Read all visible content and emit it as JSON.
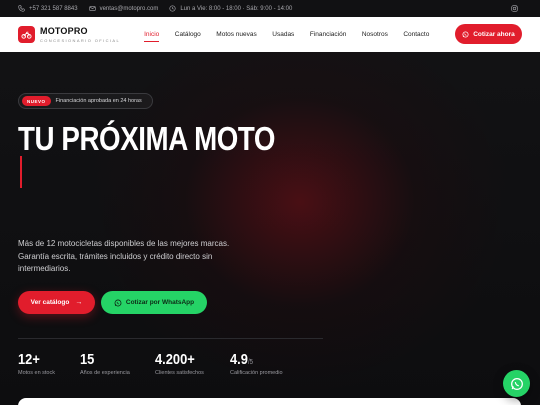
{
  "topbar": {
    "phone": "+57 321 587 8843",
    "email": "ventas@motopro.com",
    "hours": "Lun a Vie: 8:00 - 18:00 · Sáb: 9:00 - 14:00"
  },
  "nav": {
    "brand_name": "MOTOPRO",
    "brand_sub": "CONCESIONARIO OFICIAL",
    "menu": [
      "Inicio",
      "Catálogo",
      "Motos nuevas",
      "Usadas",
      "Financiación",
      "Nosotros",
      "Contacto"
    ],
    "active_item": "Inicio",
    "cta_label": "Cotizar ahora"
  },
  "hero": {
    "badge_tag": "NUEVO",
    "badge_text": "Financiación aprobada en 24 horas",
    "title": "TU PRÓXIMA MOTO",
    "description": "Más de 12 motocicletas disponibles de las mejores marcas. Garantía escrita, trámites incluidos y crédito directo sin intermediarios.",
    "primary_button": "Ver catálogo",
    "primary_arrow": "→",
    "whatsapp_button": "Cotizar por WhatsApp"
  },
  "stats": [
    {
      "value": "12+",
      "suffix": "",
      "label": "Motos en stock"
    },
    {
      "value": "15",
      "suffix": "",
      "label": "Años de experiencia"
    },
    {
      "value": "4.200+",
      "suffix": "",
      "label": "Clientes satisfechos"
    },
    {
      "value": "4.9",
      "suffix": "/5",
      "label": "Calificación promedio"
    }
  ],
  "colors": {
    "accent": "#e11d2c",
    "whatsapp": "#25d366",
    "background": "#0d0d0f"
  },
  "icons": {
    "phone": "phone-icon",
    "email": "mail-icon",
    "hours": "clock-icon",
    "social": "instagram-icon",
    "logo": "motorcycle-icon",
    "whatsapp": "whatsapp-icon"
  }
}
